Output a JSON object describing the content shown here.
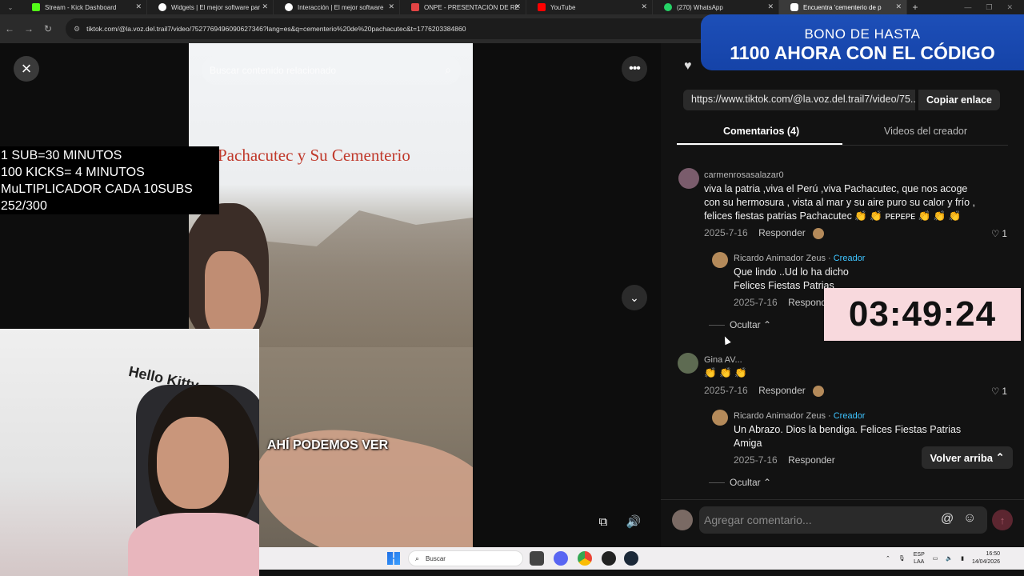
{
  "browser": {
    "tabs": [
      {
        "title": "Stream - Kick Dashboard",
        "color": "#53fc18"
      },
      {
        "title": "Widgets | El mejor software par",
        "color": "#ffffff"
      },
      {
        "title": "Interacción | El mejor software",
        "color": "#ffffff"
      },
      {
        "title": "ONPE - PRESENTACIÓN DE RE",
        "color": "#e24444"
      },
      {
        "title": "YouTube",
        "color": "#ff0000"
      },
      {
        "title": "(270) WhatsApp",
        "color": "#25d366"
      },
      {
        "title": "Encuentra 'cementerio de p",
        "color": "#ffffff"
      }
    ],
    "url": "tiktok.com/@la.voz.del.trail7/video/7527769496090627346?lang=es&q=cementerio%20de%20pachacutec&t=1776203384860"
  },
  "viewer": {
    "close_icon": "×",
    "search_placeholder": "Buscar contenido relacionado",
    "video_title": "Pachacutec y Su Cementerio",
    "caption": "AHÍ PODEMOS VER",
    "more_icon": "•••",
    "down_icon": "⌄"
  },
  "overlay": {
    "lines": [
      "1 SUB=30 MINUTOS",
      "100 KICKS= 4 MINUTOS",
      "MuLTIPLICADOR CADA 10SUBS",
      "252/300"
    ]
  },
  "webcam": {
    "shirt_text": "Hello Kitty"
  },
  "promo": {
    "line1": "BONO DE HASTA",
    "line2": "1100 AHORA CON EL CÓDIGO"
  },
  "share": {
    "link": "https://www.tiktok.com/@la.voz.del.trail7/video/75...",
    "copy_label": "Copiar enlace"
  },
  "panel_tabs": {
    "comments": "Comentarios (4)",
    "creator_videos": "Videos del creador"
  },
  "comments": [
    {
      "user": "carmenrosasalazar0",
      "text": "viva la patria ,viva el Perú ,viva Pachacutec, que nos acoge con su hermosura , vista al mar y su aire puro su calor y frío , felices fiestas patrias Pachacutec 👏 👏 ᴘᴇᴘᴇᴘᴇ 👏 👏 👏",
      "date": "2025-7-16",
      "reply_label": "Responder",
      "likes": "1",
      "reply": {
        "user": "Ricardo Animador Zeus",
        "badge": "Creador",
        "text_line1": "Que lindo ..Ud lo ha dicho",
        "text_line2": "Felices Fiestas Patrias",
        "date": "2025-7-16",
        "reply_label": "Responder"
      },
      "hide_label": "Ocultar"
    },
    {
      "user": "Gina AV...",
      "text": "👏 👏 👏",
      "date": "2025-7-16",
      "reply_label": "Responder",
      "likes": "1",
      "reply": {
        "user": "Ricardo Animador Zeus",
        "badge": "Creador",
        "text_line1": "Un Abrazo. Dios la bendiga. Felices Fiestas Patrias",
        "text_line2": "Amiga",
        "date": "2025-7-16",
        "reply_label": "Responder"
      },
      "hide_label": "Ocultar"
    }
  ],
  "timer": "03:49:24",
  "back_to_top": "Volver arriba",
  "comment_input": {
    "placeholder": "Agregar comentario..."
  },
  "taskbar": {
    "search": "Buscar",
    "lang": "ESP",
    "lang2": "LAA",
    "time": "16:50",
    "date": "14/04/2026"
  }
}
